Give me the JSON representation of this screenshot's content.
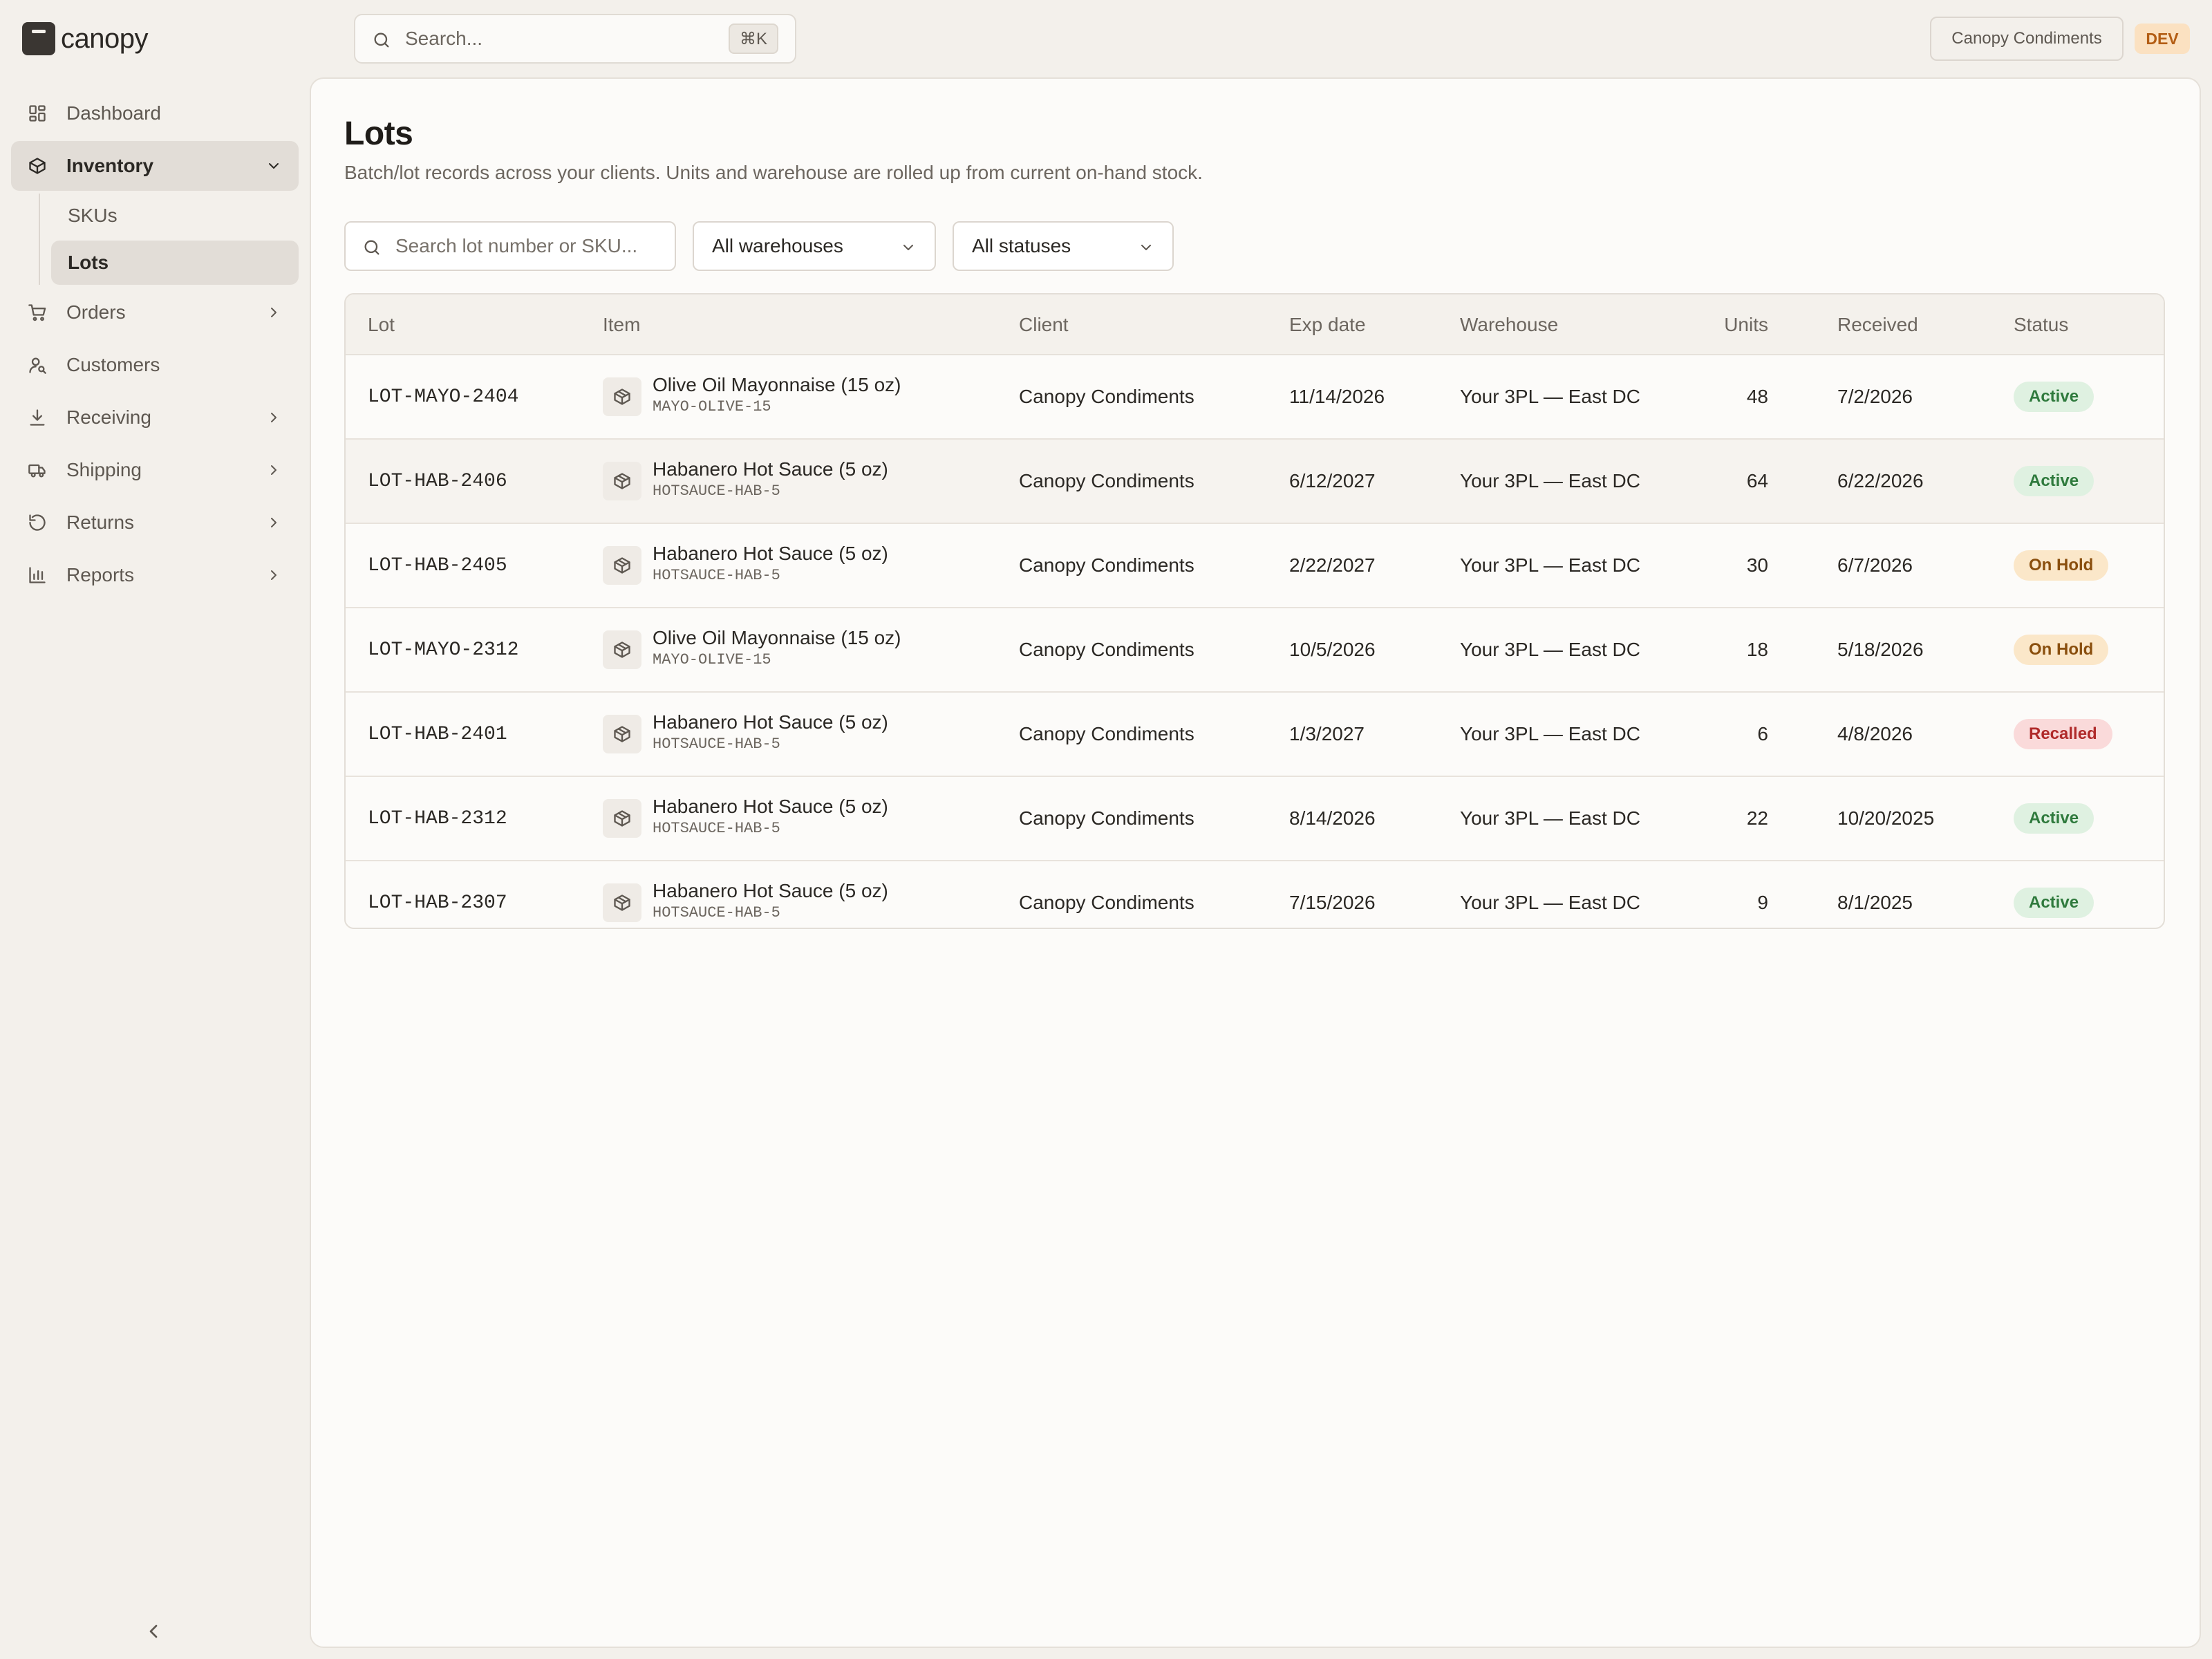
{
  "app": {
    "name": "canopy"
  },
  "topbar": {
    "search_placeholder": "Search...",
    "shortcut": "⌘K",
    "client": "Canopy Condiments",
    "env": "DEV"
  },
  "sidebar": {
    "items": [
      {
        "label": "Dashboard",
        "icon": "dashboard-icon"
      },
      {
        "label": "Inventory",
        "icon": "box-icon",
        "expanded": true,
        "children": [
          {
            "label": "SKUs"
          },
          {
            "label": "Lots",
            "active": true
          }
        ]
      },
      {
        "label": "Orders",
        "icon": "cart-icon"
      },
      {
        "label": "Customers",
        "icon": "customers-icon"
      },
      {
        "label": "Receiving",
        "icon": "download-icon"
      },
      {
        "label": "Shipping",
        "icon": "truck-icon"
      },
      {
        "label": "Returns",
        "icon": "returns-icon"
      },
      {
        "label": "Reports",
        "icon": "bar-chart-icon"
      }
    ]
  },
  "page": {
    "title": "Lots",
    "subtitle": "Batch/lot records across your clients. Units and warehouse are rolled up from current on-hand stock."
  },
  "filters": {
    "search_placeholder": "Search lot number or SKU...",
    "warehouse": "All warehouses",
    "status": "All statuses"
  },
  "table": {
    "columns": [
      "Lot",
      "Item",
      "Client",
      "Exp date",
      "Warehouse",
      "Units",
      "Received",
      "Status"
    ],
    "rows": [
      {
        "lot": "LOT-MAYO-2404",
        "item": "Olive Oil Mayonnaise (15 oz)",
        "sku": "MAYO-OLIVE-15",
        "client": "Canopy Condiments",
        "exp": "11/14/2026",
        "warehouse": "Your 3PL — East DC",
        "units": "48",
        "received": "7/2/2026",
        "status": "Active"
      },
      {
        "lot": "LOT-HAB-2406",
        "item": "Habanero Hot Sauce (5 oz)",
        "sku": "HOTSAUCE-HAB-5",
        "client": "Canopy Condiments",
        "exp": "6/12/2027",
        "warehouse": "Your 3PL — East DC",
        "units": "64",
        "received": "6/22/2026",
        "status": "Active"
      },
      {
        "lot": "LOT-HAB-2405",
        "item": "Habanero Hot Sauce (5 oz)",
        "sku": "HOTSAUCE-HAB-5",
        "client": "Canopy Condiments",
        "exp": "2/22/2027",
        "warehouse": "Your 3PL — East DC",
        "units": "30",
        "received": "6/7/2026",
        "status": "On Hold"
      },
      {
        "lot": "LOT-MAYO-2312",
        "item": "Olive Oil Mayonnaise (15 oz)",
        "sku": "MAYO-OLIVE-15",
        "client": "Canopy Condiments",
        "exp": "10/5/2026",
        "warehouse": "Your 3PL — East DC",
        "units": "18",
        "received": "5/18/2026",
        "status": "On Hold"
      },
      {
        "lot": "LOT-HAB-2401",
        "item": "Habanero Hot Sauce (5 oz)",
        "sku": "HOTSAUCE-HAB-5",
        "client": "Canopy Condiments",
        "exp": "1/3/2027",
        "warehouse": "Your 3PL — East DC",
        "units": "6",
        "received": "4/8/2026",
        "status": "Recalled"
      },
      {
        "lot": "LOT-HAB-2312",
        "item": "Habanero Hot Sauce (5 oz)",
        "sku": "HOTSAUCE-HAB-5",
        "client": "Canopy Condiments",
        "exp": "8/14/2026",
        "warehouse": "Your 3PL — East DC",
        "units": "22",
        "received": "10/20/2025",
        "status": "Active"
      },
      {
        "lot": "LOT-HAB-2307",
        "item": "Habanero Hot Sauce (5 oz)",
        "sku": "HOTSAUCE-HAB-5",
        "client": "Canopy Condiments",
        "exp": "7/15/2026",
        "warehouse": "Your 3PL — East DC",
        "units": "9",
        "received": "8/1/2025",
        "status": "Active"
      }
    ]
  },
  "colors": {
    "background": "#f3f0eb",
    "card": "#fcfbf9",
    "active_badge": "#dff1e1",
    "hold_badge": "#fbe7c9",
    "recalled_badge": "#fadada",
    "env_badge": "#fbe1c1"
  }
}
